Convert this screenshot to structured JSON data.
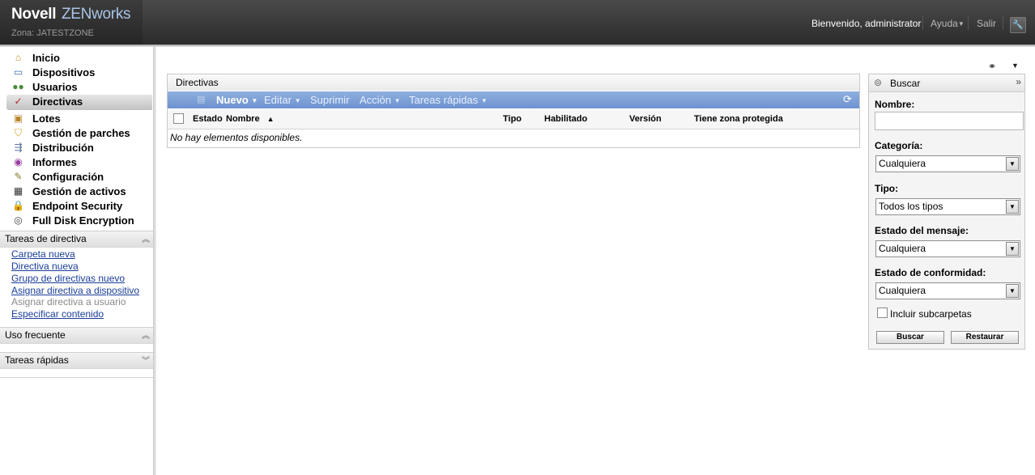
{
  "header": {
    "brand_primary": "Novell",
    "brand_product": "ZENworks",
    "zone_label": "Zona: JATESTZONE",
    "welcome": "Bienvenido, administrator",
    "help": "Ayuda",
    "logout": "Salir"
  },
  "sidebar": {
    "nav": [
      {
        "label": "Inicio",
        "icon": "home-icon"
      },
      {
        "label": "Dispositivos",
        "icon": "monitor-icon"
      },
      {
        "label": "Usuarios",
        "icon": "users-icon"
      },
      {
        "label": "Directivas",
        "icon": "policy-icon",
        "selected": true
      },
      {
        "label": "Lotes",
        "icon": "bundle-icon"
      },
      {
        "label": "Gestión de parches",
        "icon": "shield-icon"
      },
      {
        "label": "Distribución",
        "icon": "distribution-icon"
      },
      {
        "label": "Informes",
        "icon": "reports-icon"
      },
      {
        "label": "Configuración",
        "icon": "wrench-icon"
      },
      {
        "label": "Gestión de activos",
        "icon": "assets-icon"
      },
      {
        "label": "Endpoint Security",
        "icon": "lock-icon"
      },
      {
        "label": "Full Disk Encryption",
        "icon": "disk-encryption-icon"
      }
    ],
    "policy_tasks": {
      "title": "Tareas de directiva",
      "links": [
        {
          "label": "Carpeta nueva",
          "enabled": true
        },
        {
          "label": "Directiva nueva",
          "enabled": true
        },
        {
          "label": "Grupo de directivas nuevo",
          "enabled": true
        },
        {
          "label": "Asignar directiva a dispositivo",
          "enabled": true
        },
        {
          "label": "Asignar directiva a usuario",
          "enabled": false
        },
        {
          "label": "Especificar contenido",
          "enabled": true
        }
      ]
    },
    "frequent": {
      "title": "Uso frecuente"
    },
    "quick_tasks": {
      "title": "Tareas rápidas"
    }
  },
  "main": {
    "panel_title": "Directivas",
    "toolbar": {
      "new": "Nuevo",
      "edit": "Editar",
      "delete": "Suprimir",
      "action": "Acción",
      "quick_tasks": "Tareas rápidas"
    },
    "columns": [
      "Estado",
      "Nombre",
      "Tipo",
      "Habilitado",
      "Versión",
      "Tiene zona protegida"
    ],
    "sort_indicator": "▲",
    "empty_message": "No hay elementos disponibles."
  },
  "search": {
    "title": "Buscar",
    "name_label": "Nombre:",
    "name_value": "",
    "category_label": "Categoría:",
    "category_value": "Cualquiera",
    "type_label": "Tipo:",
    "type_value": "Todos los tipos",
    "message_status_label": "Estado del mensaje:",
    "message_status_value": "Cualquiera",
    "compliance_label": "Estado de conformidad:",
    "compliance_value": "Cualquiera",
    "include_subfolders_label": "Incluir subcarpetas",
    "include_subfolders_checked": false,
    "search_button": "Buscar",
    "reset_button": "Restaurar"
  },
  "colors": {
    "header_bg": "#2b2b2b",
    "toolbar_bg": "#6d92cf",
    "link": "#1a3d99",
    "brand_accent": "#a9c4e6"
  }
}
